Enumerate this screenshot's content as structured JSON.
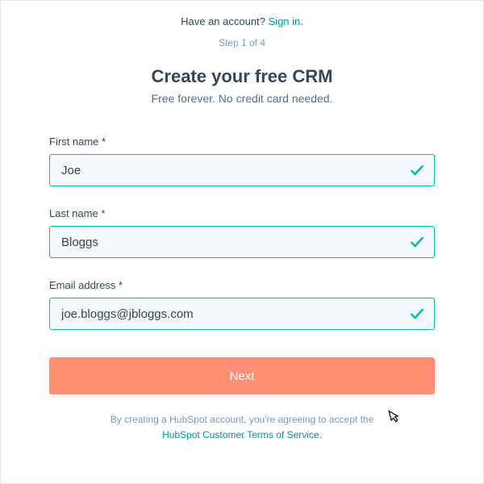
{
  "header": {
    "have_account_text": "Have an account? ",
    "sign_in_label": "Sign in",
    "period": ".",
    "step_text": "Step 1 of 4"
  },
  "title": "Create your free CRM",
  "subtitle": "Free forever. No credit card needed.",
  "fields": {
    "first_name": {
      "label": "First name *",
      "value": "Joe"
    },
    "last_name": {
      "label": "Last name *",
      "value": "Bloggs"
    },
    "email": {
      "label": "Email address *",
      "value": "joe.bloggs@jbloggs.com"
    }
  },
  "next_button_label": "Next",
  "terms": {
    "prefix": "By creating a HubSpot account, you're agreeing to accept the",
    "link_label": "HubSpot Customer Terms of Service."
  },
  "colors": {
    "teal": "#00bda5",
    "link": "#0091ae",
    "button": "#ff8f73"
  }
}
